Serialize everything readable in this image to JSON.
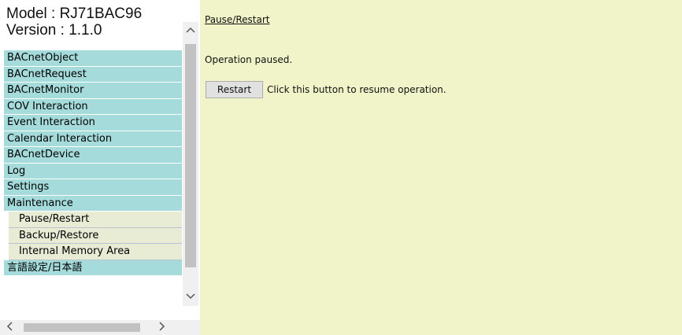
{
  "sidebar": {
    "model_line": "Model : RJ71BAC96",
    "version_line": "Version : 1.1.0",
    "menu": [
      "BACnetObject",
      "BACnetRequest",
      "BACnetMonitor",
      "COV Interaction",
      "Event Interaction",
      "Calendar Interaction",
      "BACnetDevice",
      "Log",
      "Settings",
      "Maintenance"
    ],
    "submenu": [
      "Pause/Restart",
      "Backup/Restore",
      "Internal Memory Area"
    ],
    "language": "言語設定/日本語",
    "vscroll_up_icon": "chevron-up-icon",
    "vscroll_down_icon": "chevron-down-icon",
    "hscroll_left_icon": "chevron-left-icon",
    "hscroll_right_icon": "chevron-right-icon"
  },
  "main": {
    "link": "Pause/Restart",
    "status": "Operation paused.",
    "restart_button": "Restart",
    "restart_hint": "Click this button to resume operation."
  },
  "colors": {
    "menu_bg": "#a5dbdb",
    "submenu_bg": "#e9ecd5",
    "main_bg": "#f1f4c9"
  }
}
